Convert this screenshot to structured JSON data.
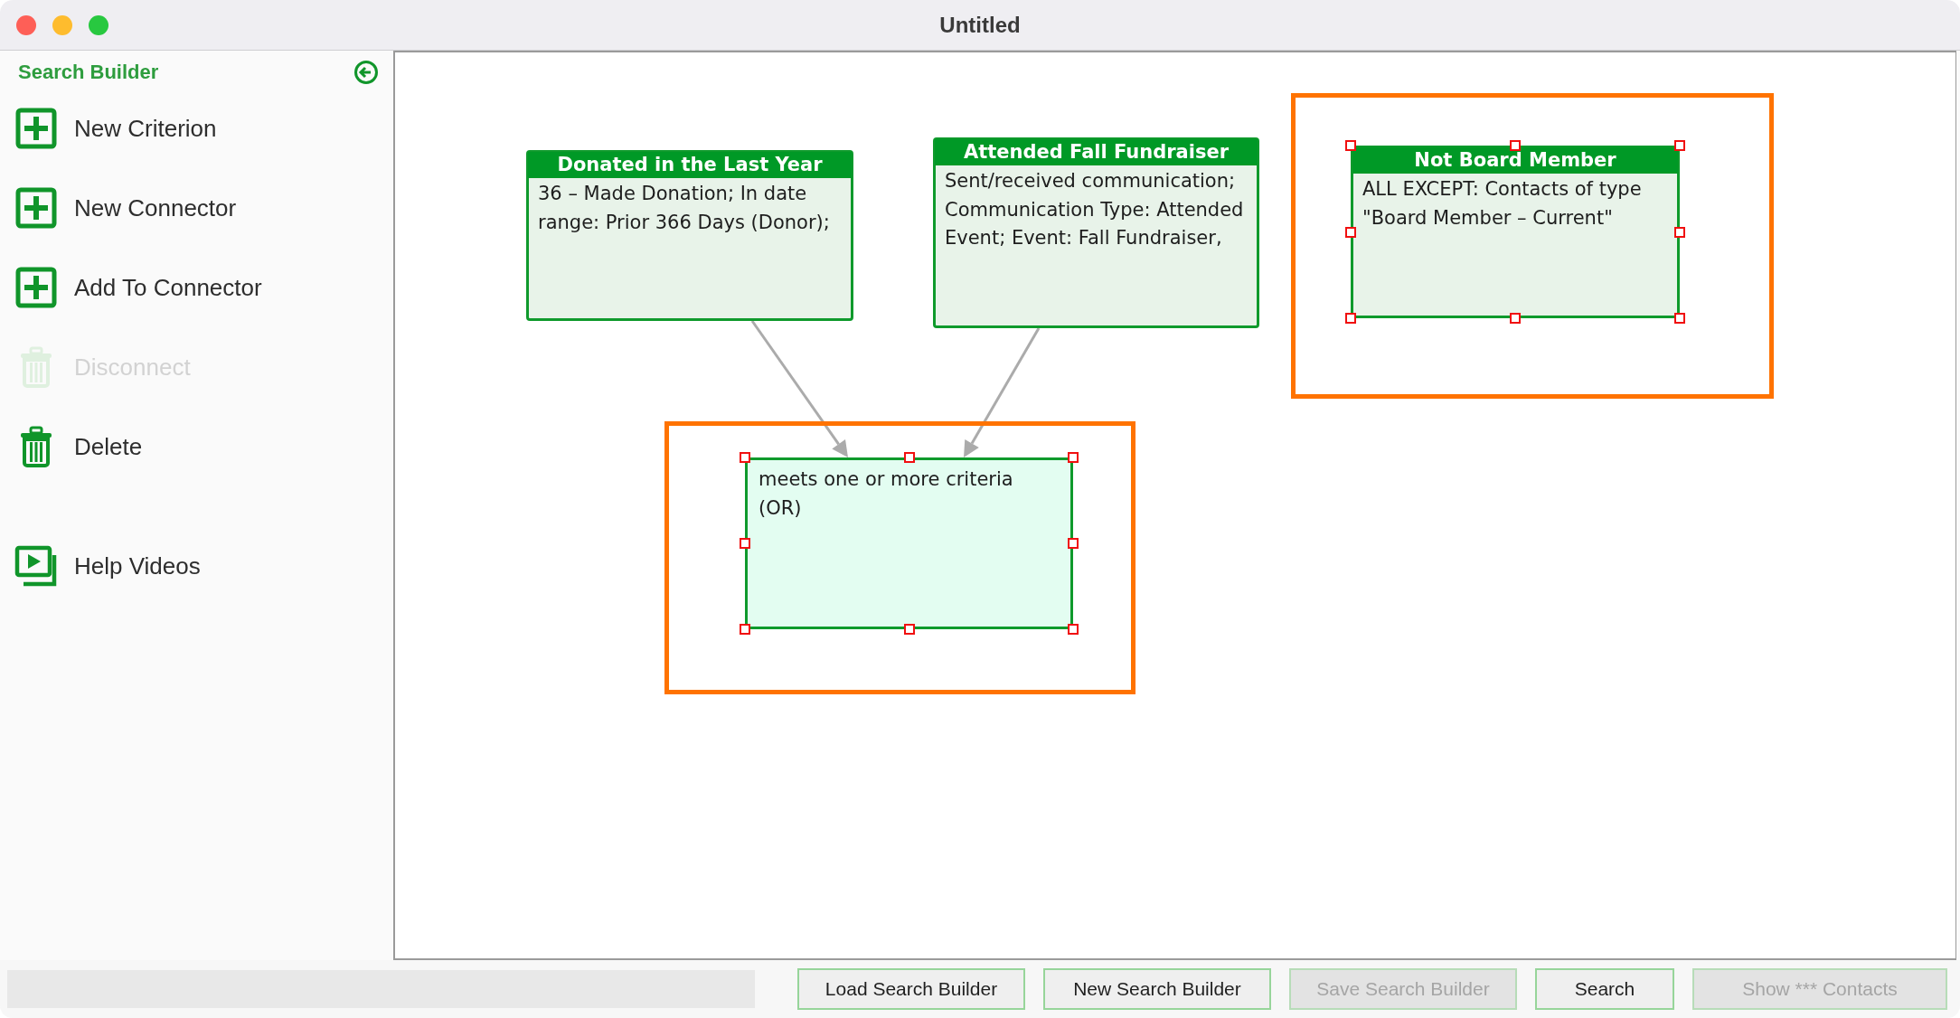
{
  "window": {
    "title": "Untitled"
  },
  "sidebar": {
    "title": "Search Builder",
    "items": [
      {
        "kind": "plus",
        "label": "New Criterion",
        "disabled": false
      },
      {
        "kind": "plus",
        "label": "New Connector",
        "disabled": false
      },
      {
        "kind": "plus",
        "label": "Add To Connector",
        "disabled": false
      },
      {
        "kind": "trash",
        "label": "Disconnect",
        "disabled": true
      },
      {
        "kind": "trash",
        "label": "Delete",
        "disabled": false
      },
      {
        "kind": "video",
        "label": "Help Videos",
        "disabled": false
      }
    ]
  },
  "canvas": {
    "nodes": [
      {
        "kind": "criterion",
        "title": "Donated in the Last Year",
        "text": "36 – Made Donation; In date range: Prior 366 Days (Donor);",
        "selected": false
      },
      {
        "kind": "criterion",
        "title": "Attended Fall Fundraiser",
        "text": "Sent/received communication; Communication Type: Attended Event; Event: Fall Fundraiser,",
        "selected": false
      },
      {
        "kind": "criterion",
        "title": "Not Board Member",
        "text": "ALL EXCEPT: Contacts of type \"Board Member – Current\"",
        "selected": true
      },
      {
        "kind": "connector",
        "text": "meets one or more criteria (OR)",
        "selected": true
      }
    ]
  },
  "buttons": [
    {
      "label": "Load Search Builder",
      "disabled": false
    },
    {
      "label": "New Search Builder",
      "disabled": false
    },
    {
      "label": "Save Search Builder",
      "disabled": true
    },
    {
      "label": "Search",
      "disabled": false
    },
    {
      "label": "Show *** Contacts",
      "disabled": true
    }
  ]
}
